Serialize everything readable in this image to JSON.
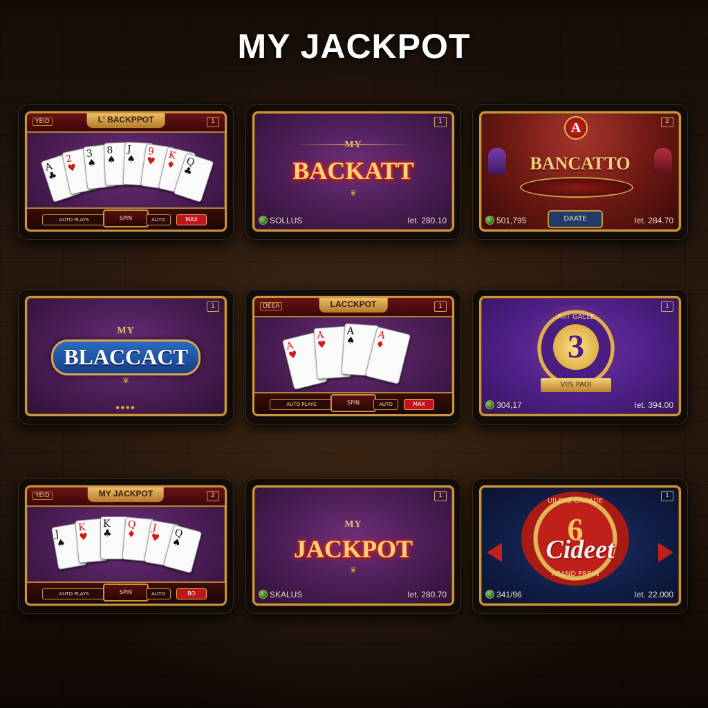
{
  "page": {
    "title": "MY JACKPOT"
  },
  "tiles": [
    {
      "tag": "L' BACKPPOT",
      "top_left": "YEID",
      "top_right": "1",
      "bar_left": "AUTO PLAYS",
      "bar_mid": "SPIN",
      "bar_right_a": "AUTO",
      "bar_red": "MAX"
    },
    {
      "small": "MY",
      "logo": "BACKATT",
      "top_right": "1",
      "foot_left": "SOLLUS",
      "foot_right": "Iet. 280.10"
    },
    {
      "logo": "BANCATTO",
      "emblem": "A",
      "top_right": "2",
      "button": "DAATE",
      "foot_left": "501,795",
      "foot_right": "Iet. 284.70"
    },
    {
      "small": "MY",
      "logo": "BLACCACT",
      "top_right": "1"
    },
    {
      "tag": "LACCKPOT",
      "top_left": "DEEA",
      "top_right": "1",
      "bar_left": "AUTO PLAYS",
      "bar_mid": "SPIN",
      "bar_right_a": "AUTO",
      "bar_red": "MAX"
    },
    {
      "ring_text": "RIIT GALLE",
      "number": "3",
      "ribbon": "VIIS PAOI",
      "top_right": "1",
      "foot_left": "304,17",
      "foot_right": "Iet. 394.00"
    },
    {
      "tag": "MY JACKPOT",
      "top_left": "YEID",
      "top_right": "2",
      "bar_left": "AUTO PLAYS",
      "bar_mid": "SPIN",
      "bar_right_a": "AUTO",
      "bar_red": "BO"
    },
    {
      "small": "MY",
      "logo": "JACKPOT",
      "top_right": "1",
      "foot_left": "SKALUS",
      "foot_right": "Iet. 280.70"
    },
    {
      "ring_top": "UILEIIB CAGADE",
      "logo": "Cideet",
      "number": "6",
      "ring_bottom": "ARAND PRRIN",
      "top_right": "1",
      "foot_left": "341/96",
      "foot_right": "Iet. 22.000"
    }
  ],
  "colors": {
    "gold": "#c9953f",
    "purple": "#4a1d55",
    "violet": "#4b1f82",
    "navy": "#101d45",
    "red": "#c2141b"
  }
}
